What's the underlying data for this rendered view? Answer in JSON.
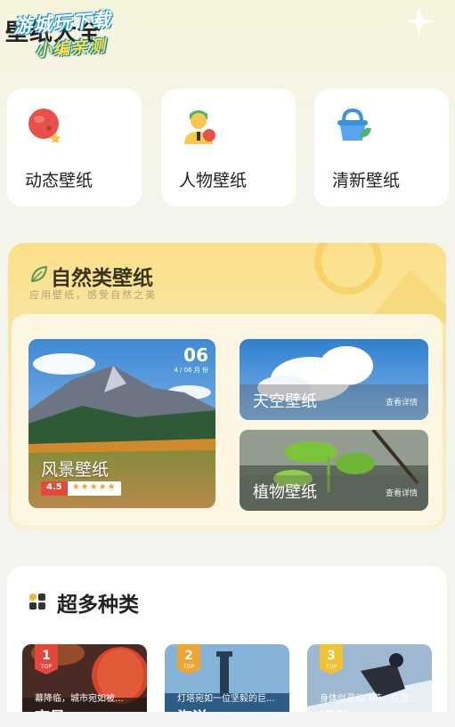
{
  "header": {
    "title": "壁纸大全",
    "watermark_line1": "游城玩下载",
    "watermark_line2": "小编亲测"
  },
  "categories": [
    {
      "label": "动态壁纸",
      "icon": "planet-icon"
    },
    {
      "label": "人物壁纸",
      "icon": "person-icon"
    },
    {
      "label": "清新壁纸",
      "icon": "basket-icon"
    }
  ],
  "nature": {
    "title": "自然类壁纸",
    "subtitle": "应用壁纸，感受自然之美",
    "landscape": {
      "label": "风景壁纸",
      "rating": "4.5",
      "stars": "★★★★★",
      "date_day": "06",
      "date_sub": "4 / 06 月 份"
    },
    "sky": {
      "label": "天空壁纸",
      "link": "查看详情"
    },
    "plant": {
      "label": "植物壁纸",
      "link": "查看详情"
    }
  },
  "variety": {
    "title": "超多种类",
    "items": [
      {
        "rank": "1",
        "top": "TOP",
        "desc": "幕降临，城市宛如被...",
        "name": "夜景",
        "badge_color": "#e5483b"
      },
      {
        "rank": "2",
        "top": "TOP",
        "desc": "灯塔宛如一位坚毅的巨...",
        "name": "海洋",
        "badge_color": "#f2a431"
      },
      {
        "rank": "3",
        "top": "TOP",
        "desc": "身体似灵动飞燕，在雪...",
        "name": "运动",
        "badge_color": "#f2c131"
      }
    ]
  },
  "colors": {
    "accent_yellow": "#fbe08a",
    "red": "#e5483b"
  }
}
